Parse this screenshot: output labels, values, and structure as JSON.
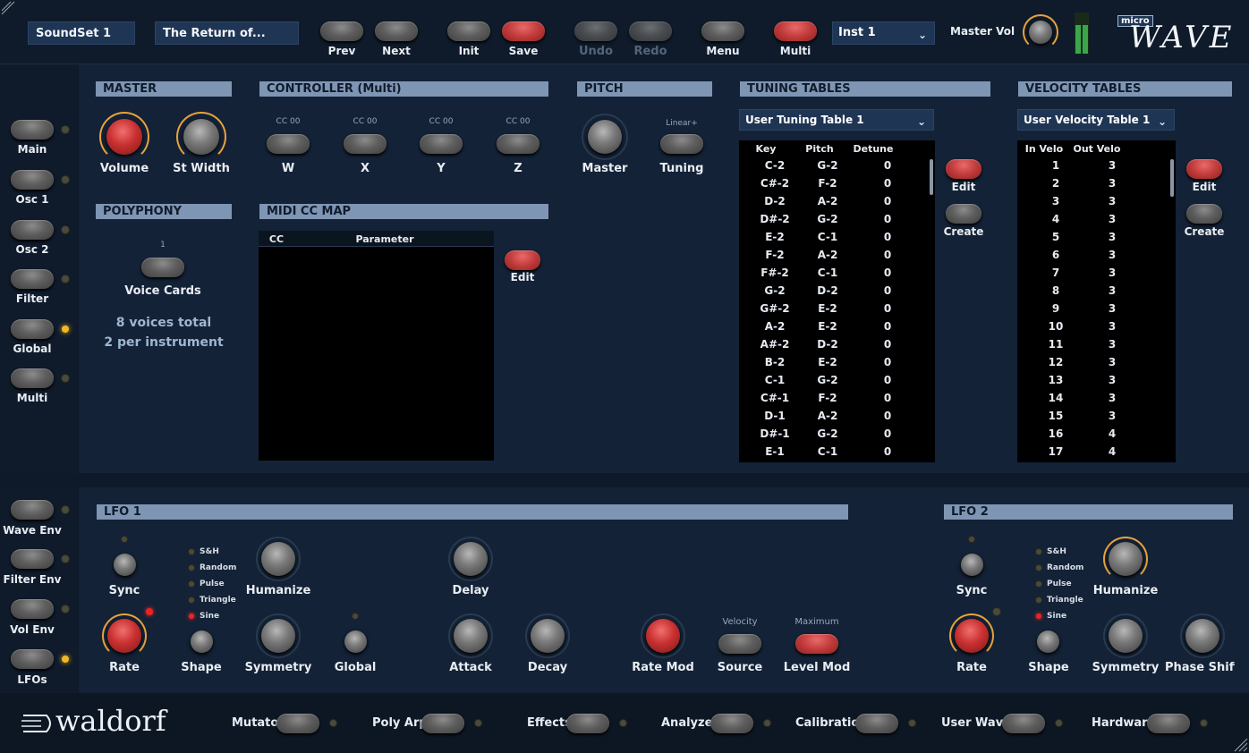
{
  "top": {
    "soundset": "SoundSet 1",
    "preset": "The Return of...",
    "prev": "Prev",
    "next": "Next",
    "init": "Init",
    "save": "Save",
    "undo": "Undo",
    "redo": "Redo",
    "menu": "Menu",
    "multi": "Multi",
    "instrument": "Inst 1",
    "master_vol": "Master Vol",
    "logo_small": "micro",
    "logo_big": "WAVE"
  },
  "nav": {
    "upper": [
      "Main",
      "Osc 1",
      "Osc 2",
      "Filter",
      "Global",
      "Multi"
    ],
    "lower": [
      "Wave Env",
      "Filter Env",
      "Vol Env",
      "LFOs"
    ]
  },
  "master": {
    "title": "MASTER",
    "volume": "Volume",
    "st_width": "St Width"
  },
  "controller": {
    "title": "CONTROLLER (Multi)",
    "cc": [
      "CC 00",
      "CC 00",
      "CC 00",
      "CC 00"
    ],
    "labels": [
      "W",
      "X",
      "Y",
      "Z"
    ]
  },
  "pitch": {
    "title": "PITCH",
    "master": "Master",
    "tuning": "Tuning",
    "mode": "Linear+"
  },
  "polyphony": {
    "title": "POLYPHONY",
    "count": "1",
    "voice_cards": "Voice Cards",
    "voices_total": "8 voices total",
    "per_instrument": "2 per instrument"
  },
  "midi": {
    "title": "MIDI CC MAP",
    "col_cc": "CC",
    "col_param": "Parameter",
    "edit": "Edit"
  },
  "tuning": {
    "title": "TUNING TABLES",
    "selected": "User Tuning Table 1",
    "col_key": "Key",
    "col_pitch": "Pitch",
    "col_detune": "Detune",
    "edit": "Edit",
    "create": "Create",
    "rows": [
      [
        "C-2",
        "G-2",
        "0"
      ],
      [
        "C#-2",
        "F-2",
        "0"
      ],
      [
        "D-2",
        "A-2",
        "0"
      ],
      [
        "D#-2",
        "G-2",
        "0"
      ],
      [
        "E-2",
        "C-1",
        "0"
      ],
      [
        "F-2",
        "A-2",
        "0"
      ],
      [
        "F#-2",
        "C-1",
        "0"
      ],
      [
        "G-2",
        "D-2",
        "0"
      ],
      [
        "G#-2",
        "E-2",
        "0"
      ],
      [
        "A-2",
        "E-2",
        "0"
      ],
      [
        "A#-2",
        "D-2",
        "0"
      ],
      [
        "B-2",
        "E-2",
        "0"
      ],
      [
        "C-1",
        "G-2",
        "0"
      ],
      [
        "C#-1",
        "F-2",
        "0"
      ],
      [
        "D-1",
        "A-2",
        "0"
      ],
      [
        "D#-1",
        "G-2",
        "0"
      ],
      [
        "E-1",
        "C-1",
        "0"
      ]
    ]
  },
  "velocity": {
    "title": "VELOCITY TABLES",
    "selected": "User Velocity Table 1",
    "col_in": "In Velo",
    "col_out": "Out Velo",
    "edit": "Edit",
    "create": "Create",
    "rows": [
      [
        "1",
        "3"
      ],
      [
        "2",
        "3"
      ],
      [
        "3",
        "3"
      ],
      [
        "4",
        "3"
      ],
      [
        "5",
        "3"
      ],
      [
        "6",
        "3"
      ],
      [
        "7",
        "3"
      ],
      [
        "8",
        "3"
      ],
      [
        "9",
        "3"
      ],
      [
        "10",
        "3"
      ],
      [
        "11",
        "3"
      ],
      [
        "12",
        "3"
      ],
      [
        "13",
        "3"
      ],
      [
        "14",
        "3"
      ],
      [
        "15",
        "3"
      ],
      [
        "16",
        "4"
      ],
      [
        "17",
        "4"
      ]
    ]
  },
  "lfo1": {
    "title": "LFO 1",
    "sync": "Sync",
    "rate": "Rate",
    "shape": "Shape",
    "humanize": "Humanize",
    "symmetry": "Symmetry",
    "global": "Global",
    "delay": "Delay",
    "attack": "Attack",
    "decay": "Decay",
    "rate_mod": "Rate Mod",
    "source": "Source",
    "source_val": "Velocity",
    "level_mod": "Level Mod",
    "level_val": "Maximum",
    "shapes": [
      "S&H",
      "Random",
      "Pulse",
      "Triangle",
      "Sine"
    ]
  },
  "lfo2": {
    "title": "LFO 2",
    "sync": "Sync",
    "rate": "Rate",
    "shape": "Shape",
    "humanize": "Humanize",
    "symmetry": "Symmetry",
    "phase_shift": "Phase Shift",
    "shapes": [
      "S&H",
      "Random",
      "Pulse",
      "Triangle",
      "Sine"
    ]
  },
  "footer": {
    "brand": "waldorf",
    "items": [
      "Mutator",
      "Poly Arp",
      "Effects",
      "Analyzer",
      "Calibration",
      "User Wave",
      "Hardware"
    ]
  },
  "colors": {
    "accent_red": "#c93030",
    "header": "#7f95b4",
    "ring": "#e9a23b",
    "led_on": "#f2b824"
  }
}
